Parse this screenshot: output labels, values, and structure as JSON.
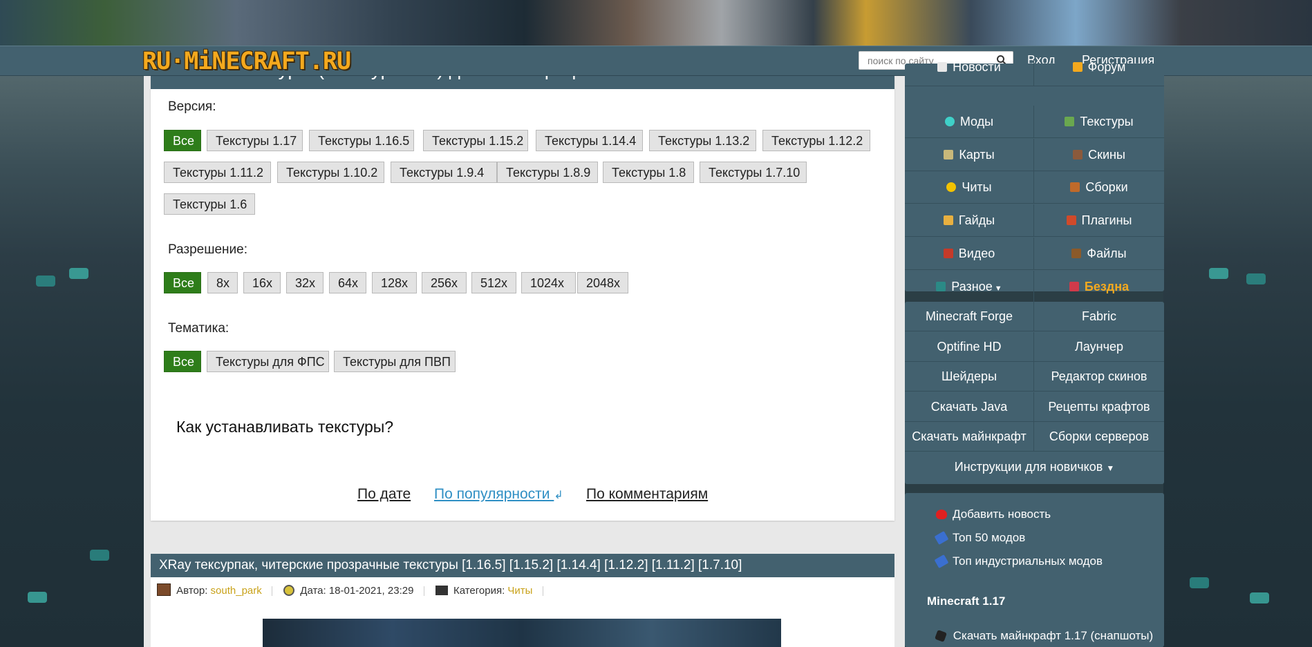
{
  "site": {
    "logo": "RU·MiNECRAFT.RU"
  },
  "header": {
    "search_placeholder": "поиск по сайту",
    "login": "Вход",
    "register": "Регистрация"
  },
  "page": {
    "title": "Скачать текстуры (текстур паки) для Майнкрафт",
    "version_label": "Версия:",
    "versions": [
      "Все",
      "Текстуры 1.17",
      "Текстуры 1.16.5",
      "Текстуры 1.15.2",
      "Текстуры 1.14.4",
      "Текстуры 1.13.2",
      "Текстуры 1.12.2",
      "Текстуры 1.11.2",
      "Текстуры 1.10.2",
      "Текстуры 1.9.4",
      "Текстуры 1.8.9",
      "Текстуры 1.8",
      "Текстуры 1.7.10",
      "Текстуры 1.6"
    ],
    "resolution_label": "Разрешение:",
    "resolutions": [
      "Все",
      "8x",
      "16x",
      "32x",
      "64x",
      "128x",
      "256x",
      "512x",
      "1024x",
      "2048x"
    ],
    "theme_label": "Тематика:",
    "themes": [
      "Все",
      "Текстуры для ФПС",
      "Текстуры для ПВП"
    ],
    "howto": "Как устанавливать текстуры?",
    "sort": {
      "by_date": "По дате",
      "by_popularity": "По популярности",
      "by_comments": "По комментариям"
    }
  },
  "article": {
    "title": "XRay тексурпак, читерские прозрачные текстуры [1.16.5] [1.15.2] [1.14.4] [1.12.2] [1.11.2] [1.7.10]",
    "author_label": "Автор:",
    "author": "south_park",
    "date_label": "Дата: 18-01-2021, 23:29",
    "category_label": "Категория:",
    "category": "Читы"
  },
  "sidebar": {
    "menu": [
      [
        "Новости",
        "Форум"
      ],
      [
        "Моды",
        "Текстуры"
      ],
      [
        "Карты",
        "Скины"
      ],
      [
        "Читы",
        "Сборки"
      ],
      [
        "Гайды",
        "Плагины"
      ],
      [
        "Видео",
        "Файлы"
      ],
      [
        "Разное",
        "Бездна"
      ]
    ],
    "links": [
      [
        "Minecraft Forge",
        "Fabric"
      ],
      [
        "Optifine HD",
        "Лаунчер"
      ],
      [
        "Шейдеры",
        "Редактор скинов"
      ],
      [
        "Скачать Java",
        "Рецепты крафтов"
      ],
      [
        "Скачать майнкрафт",
        "Сборки серверов"
      ]
    ],
    "newbie": "Инструкции для новичков",
    "actions": [
      "Добавить новость",
      "Топ 50 модов",
      "Топ индустриальных модов"
    ],
    "mc_heading": "Minecraft 1.17",
    "mc_link": "Скачать майнкрафт 1.17 (снапшоты)",
    "accent": "#f4a91e"
  }
}
